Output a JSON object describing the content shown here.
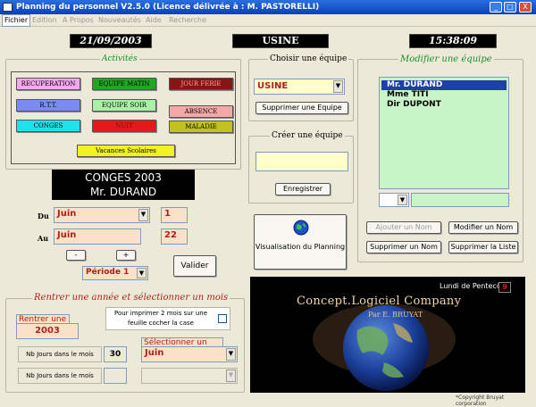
{
  "window": {
    "title": "Planning du personnel V2.5.0 (Licence délivrée à : M. PASTORELLI)",
    "minimize_label": "_",
    "maximize_label": "□",
    "close_label": "X"
  },
  "menu": {
    "items": [
      "Fichier",
      "Edition",
      "A Propos",
      "Nouveautés",
      "Aide",
      "Recherche"
    ]
  },
  "header": {
    "date": "21/09/2003",
    "site": "USINE",
    "time": "15:38:09"
  },
  "activites": {
    "title": "Activités",
    "buttons": [
      {
        "label": "RECUPERATION",
        "color": "#f4a6ee"
      },
      {
        "label": "EQUIPE MATIN",
        "color": "#1fa81f"
      },
      {
        "label": "JOUR FERIE",
        "color": "#8a1414"
      },
      {
        "label": "R.T.T.",
        "color": "#7a8cf2"
      },
      {
        "label": "EQUIPE SOIR",
        "color": "#a8f2a8"
      },
      {
        "label": "ABSENCE",
        "color": "#f5a8a8"
      },
      {
        "label": "CONGES",
        "color": "#1ee2ea"
      },
      {
        "label": "NUIT",
        "color": "#e21a1a"
      },
      {
        "label": "MALADIE",
        "color": "#c2c21e"
      },
      {
        "label": "Vacances Scolaires",
        "color": "#f2f21e"
      }
    ]
  },
  "conges": {
    "line1": "CONGES 2003",
    "line2": "Mr. DURAND",
    "du_label": "Du",
    "au_label": "Au",
    "du_month": "Juin",
    "du_day": "1",
    "au_month": "Juin",
    "au_day": "22",
    "minus_label": "-",
    "plus_label": "+",
    "periode": "Période 1",
    "valider_label": "Valider"
  },
  "equipe": {
    "choose_title": "Choisir une équipe",
    "selected": "USINE",
    "delete_label": "Supprimer une Equipe",
    "create_title": "Créer une équipe",
    "new_value": "",
    "save_label": "Enregistrer",
    "visu_label": "Visualisation du Planning"
  },
  "modify": {
    "title": "Modifier une équipe",
    "members": [
      "Mr.  DURAND",
      "Mme  TITI",
      "Dir  DUPONT"
    ],
    "selected_index": 0,
    "add_label": "Ajouter un Nom",
    "modify_label": "Modifier un Nom",
    "delete_name_label": "Supprimer un Nom",
    "delete_list_label": "Supprimer la Liste"
  },
  "year": {
    "title": "Rentrer une année et sélectionner un mois",
    "year_label": "Rentrer une année",
    "year_value": "2003",
    "print_note": "Pour imprimer 2 mois sur une feuille cocher la case",
    "nb_label1": "Nb Jours dans le mois",
    "nb_value1": "30",
    "nb_label2": "Nb Jours dans le mois",
    "nb_value2": "",
    "month_label": "Sélectionner un mois",
    "month_value": "Juin"
  },
  "banner": {
    "holiday_label": "Lundi de Pentecôte",
    "holiday_value": "9",
    "logo_line1": "Concept.Logiciel Company",
    "logo_line2": "Par E. BRUYAT",
    "copyright": "*Copyright Bruyat corporation"
  }
}
